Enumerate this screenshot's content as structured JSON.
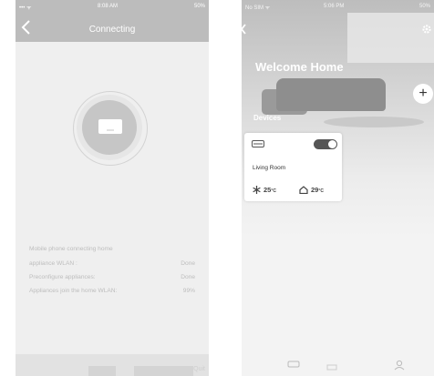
{
  "left_phone": {
    "status": {
      "carrier": "•••  ᯤ",
      "time": "8:08 AM",
      "battery": "50%"
    },
    "header": {
      "title": "Connecting"
    },
    "progress": [
      {
        "label": "Mobile phone connecting home",
        "value": ""
      },
      {
        "label": "appliance WLAN :",
        "value": "Done"
      },
      {
        "label": "Preconfigure appliances:",
        "value": "Done"
      },
      {
        "label": "Appliances join the home WLAN:",
        "value": "99%"
      }
    ],
    "footer": {
      "quit_label": "Quit"
    }
  },
  "right_phone": {
    "status": {
      "carrier": "No SIM ᯤ",
      "time": "5:06 PM",
      "battery": "50%"
    },
    "welcome": "Welcome Home",
    "add_label": "+",
    "devices_label": "Devices",
    "device_card": {
      "name": "Living Room",
      "set_temp": "25",
      "set_unit": "°C",
      "indoor_temp": "29",
      "indoor_unit": "°C",
      "power_on": true
    },
    "tabs": [
      "device-tab-icon",
      "scene-tab-icon",
      "profile-tab-icon"
    ]
  }
}
